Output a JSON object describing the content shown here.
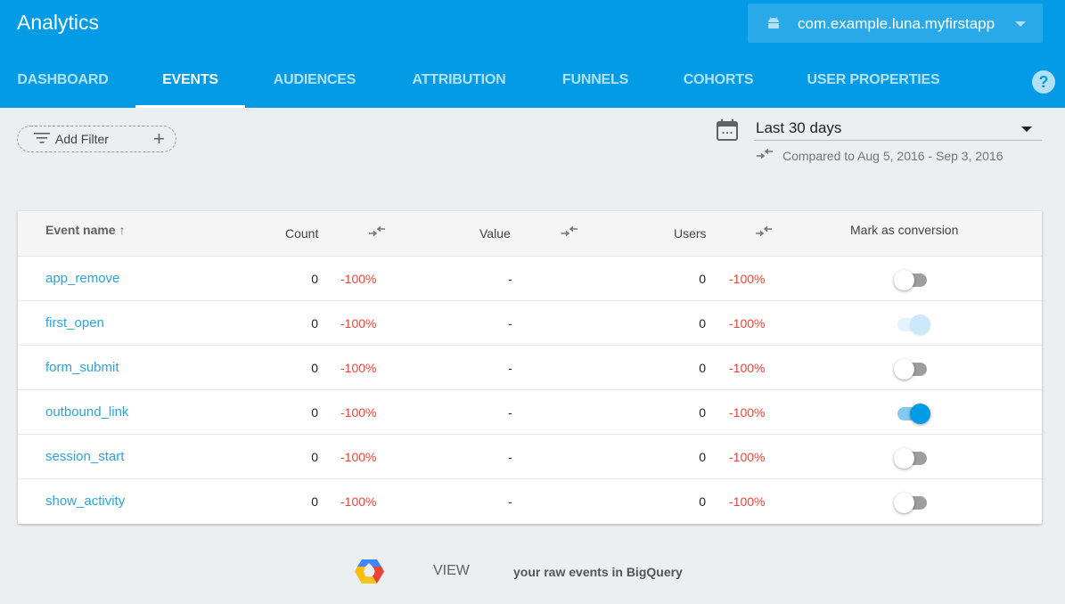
{
  "app": {
    "title": "Analytics",
    "selected_app": "com.example.luna.myfirstapp",
    "platform_icon": "android-icon"
  },
  "tabs": [
    {
      "label": "DASHBOARD",
      "active": false
    },
    {
      "label": "EVENTS",
      "active": true
    },
    {
      "label": "AUDIENCES",
      "active": false
    },
    {
      "label": "ATTRIBUTION",
      "active": false
    },
    {
      "label": "FUNNELS",
      "active": false
    },
    {
      "label": "COHORTS",
      "active": false
    },
    {
      "label": "USER PROPERTIES",
      "active": false
    }
  ],
  "help_label": "?",
  "filter": {
    "label": "Add Filter",
    "plus": "+"
  },
  "date_range": {
    "selected": "Last 30 days",
    "compared_text": "Compared to Aug 5, 2016 - Sep 3, 2016"
  },
  "table": {
    "headers": {
      "event_name": "Event name ↑",
      "count": "Count",
      "value": "Value",
      "users": "Users",
      "conversion": "Mark as conversion"
    },
    "rows": [
      {
        "name": "app_remove",
        "count": "0",
        "count_change": "-100%",
        "value": "-",
        "users": "0",
        "users_change": "-100%",
        "conversion": "off"
      },
      {
        "name": "first_open",
        "count": "0",
        "count_change": "-100%",
        "value": "-",
        "users": "0",
        "users_change": "-100%",
        "conversion": "on-disabled"
      },
      {
        "name": "form_submit",
        "count": "0",
        "count_change": "-100%",
        "value": "-",
        "users": "0",
        "users_change": "-100%",
        "conversion": "off"
      },
      {
        "name": "outbound_link",
        "count": "0",
        "count_change": "-100%",
        "value": "-",
        "users": "0",
        "users_change": "-100%",
        "conversion": "on"
      },
      {
        "name": "session_start",
        "count": "0",
        "count_change": "-100%",
        "value": "-",
        "users": "0",
        "users_change": "-100%",
        "conversion": "off"
      },
      {
        "name": "show_activity",
        "count": "0",
        "count_change": "-100%",
        "value": "-",
        "users": "0",
        "users_change": "-100%",
        "conversion": "off"
      }
    ]
  },
  "bigquery": {
    "view_label": "VIEW",
    "text": "your raw events in BigQuery"
  },
  "colors": {
    "primary": "#039be5",
    "link": "#2aa4de",
    "negative": "#f44336",
    "background": "#eceff1"
  }
}
